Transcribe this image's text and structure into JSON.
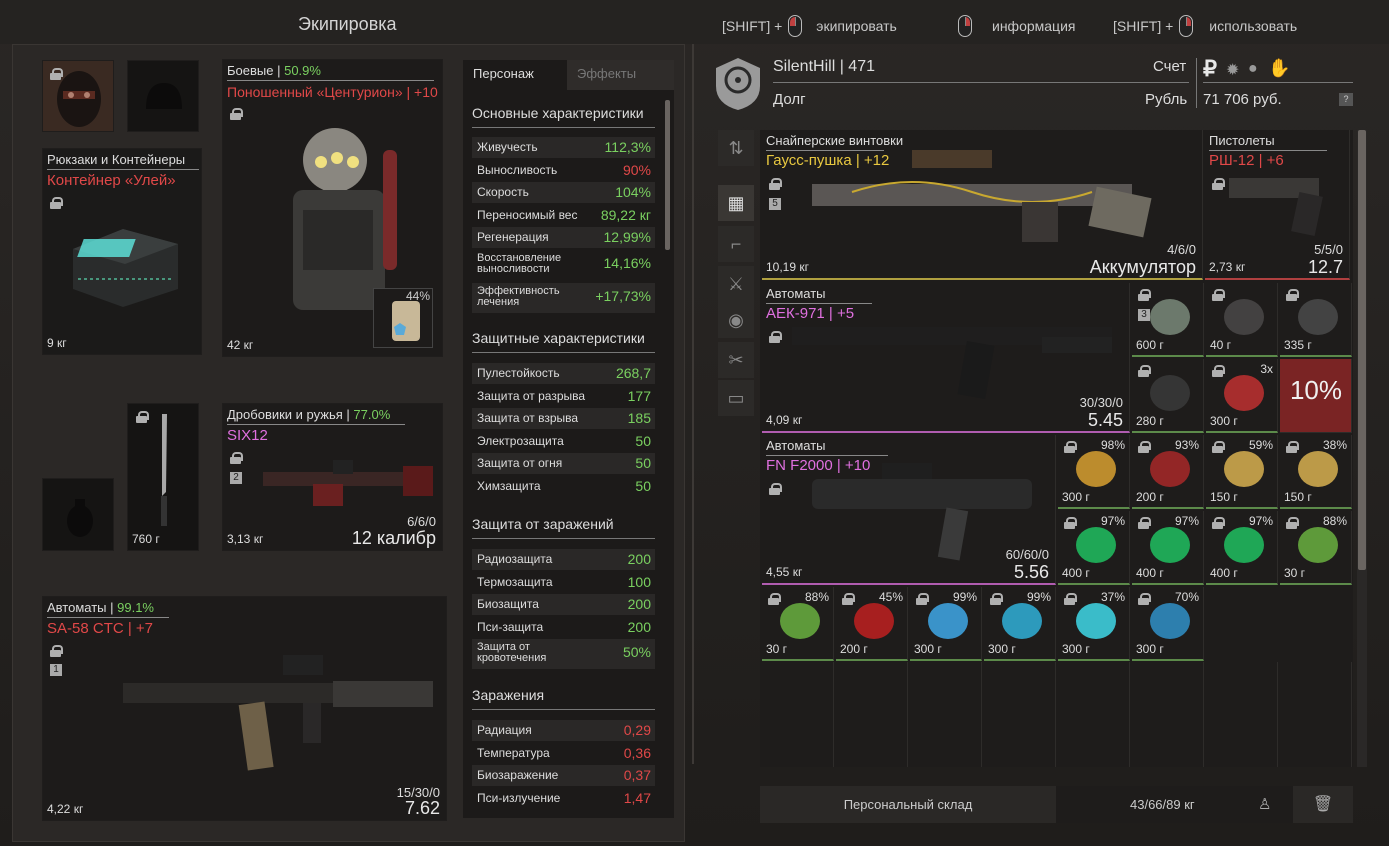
{
  "title": "Экипировка",
  "hints": [
    {
      "prefix": "[SHIFT] +",
      "label": "экипировать"
    },
    {
      "prefix": "",
      "label": "информация"
    },
    {
      "prefix": "[SHIFT] +",
      "label": "использовать"
    }
  ],
  "player": {
    "name": "SilentHill | 471",
    "account_label": "Счет",
    "debt_label": "Долг",
    "currency_label": "Рубль",
    "balance": "71 706 руб.",
    "currency_symbol": "₽",
    "help": "?"
  },
  "left": {
    "armor": {
      "category": "Боевые",
      "percent": "50.9%",
      "name": "Поношенный «Центурион» | +10",
      "weight": "42 кг",
      "plate_percent": "44%"
    },
    "backpack": {
      "category": "Рюкзаки и Контейнеры",
      "name": "Контейнер «Улей»",
      "weight": "9 кг"
    },
    "melee": {
      "weight": "760 г"
    },
    "shotgun": {
      "category": "Дробовики и ружья",
      "percent": "77.0%",
      "name": "SIX12",
      "slot": "2",
      "weight": "3,13 кг",
      "ammo": "6/6/0",
      "caliber": "12 калибр"
    },
    "rifle": {
      "category": "Автоматы",
      "percent": "99.1%",
      "name": "SA-58 CTC | +7",
      "slot": "1",
      "weight": "4,22 кг",
      "ammo": "15/30/0",
      "caliber": "7.62"
    }
  },
  "tabs": [
    "Персонаж",
    "Эффекты"
  ],
  "stats": {
    "main_title": "Основные характеристики",
    "main": [
      [
        "Живучесть",
        "112,3%"
      ],
      [
        "Выносливость",
        "90%"
      ],
      [
        "Скорость",
        "104%"
      ],
      [
        "Переносимый вес",
        "89,22 кг"
      ],
      [
        "Регенерация",
        "12,99%"
      ],
      [
        "Восстановление выносливости",
        "14,16%"
      ],
      [
        "Эффективность лечения",
        "+17,73%"
      ]
    ],
    "protect_title": "Защитные характеристики",
    "protect": [
      [
        "Пулестойкость",
        "268,7"
      ],
      [
        "Защита от разрыва",
        "177"
      ],
      [
        "Защита от взрыва",
        "185"
      ],
      [
        "Электрозащита",
        "50"
      ],
      [
        "Защита от огня",
        "50"
      ],
      [
        "Химзащита",
        "50"
      ]
    ],
    "infect_title": "Защита от заражений",
    "infect": [
      [
        "Радиозащита",
        "200"
      ],
      [
        "Термозащита",
        "100"
      ],
      [
        "Биозащита",
        "200"
      ],
      [
        "Пси-защита",
        "200"
      ],
      [
        "Защита от кровотечения",
        "50%"
      ]
    ],
    "cont_title": "Заражения",
    "cont": [
      [
        "Радиация",
        "0,29"
      ],
      [
        "Температура",
        "0,36"
      ],
      [
        "Биозаражение",
        "0,37"
      ],
      [
        "Пси-излучение",
        "1,47"
      ]
    ]
  },
  "inventory": {
    "gauss": {
      "category": "Снайперские винтовки",
      "name": "Гаусс-пушка | +12",
      "slot": "5",
      "weight": "10,19 кг",
      "ammo": "4/6/0",
      "caliber": "Аккумулятор"
    },
    "pistol": {
      "category": "Пистолеты",
      "name": "РШ-12 | +6",
      "weight": "2,73 кг",
      "ammo": "5/5/0",
      "caliber": "12.7"
    },
    "aek": {
      "category": "Автоматы",
      "name": "АЕК-971 | +5",
      "weight": "4,09 кг",
      "ammo": "30/30/0",
      "caliber": "5.45"
    },
    "fn": {
      "category": "Автоматы",
      "name": "FN F2000 | +10",
      "weight": "4,55 кг",
      "ammo": "60/60/0",
      "caliber": "5.56"
    },
    "small": [
      {
        "w": "600 г",
        "badge": "3"
      },
      {
        "w": "40 г"
      },
      {
        "w": "335 г"
      },
      {
        "w": "280 г"
      },
      {
        "w": "300 г",
        "count": "3x"
      },
      {
        "w": "10%"
      },
      {
        "w": "300 г",
        "p": "98%"
      },
      {
        "w": "200 г",
        "p": "93%"
      },
      {
        "w": "150 г",
        "p": "59%"
      },
      {
        "w": "150 г",
        "p": "38%"
      },
      {
        "w": "400 г",
        "p": "97%"
      },
      {
        "w": "400 г",
        "p": "97%"
      },
      {
        "w": "400 г",
        "p": "97%"
      },
      {
        "w": "30 г",
        "p": "88%"
      },
      {
        "w": "30 г",
        "p": "88%"
      },
      {
        "w": "200 г",
        "p": "45%"
      },
      {
        "w": "300 г",
        "p": "99%"
      },
      {
        "w": "300 г",
        "p": "99%"
      },
      {
        "w": "300 г",
        "p": "37%"
      },
      {
        "w": "300 г",
        "p": "70%"
      }
    ]
  },
  "bottom": {
    "storage": "Персональный склад",
    "weight": "43/66/89 кг"
  }
}
